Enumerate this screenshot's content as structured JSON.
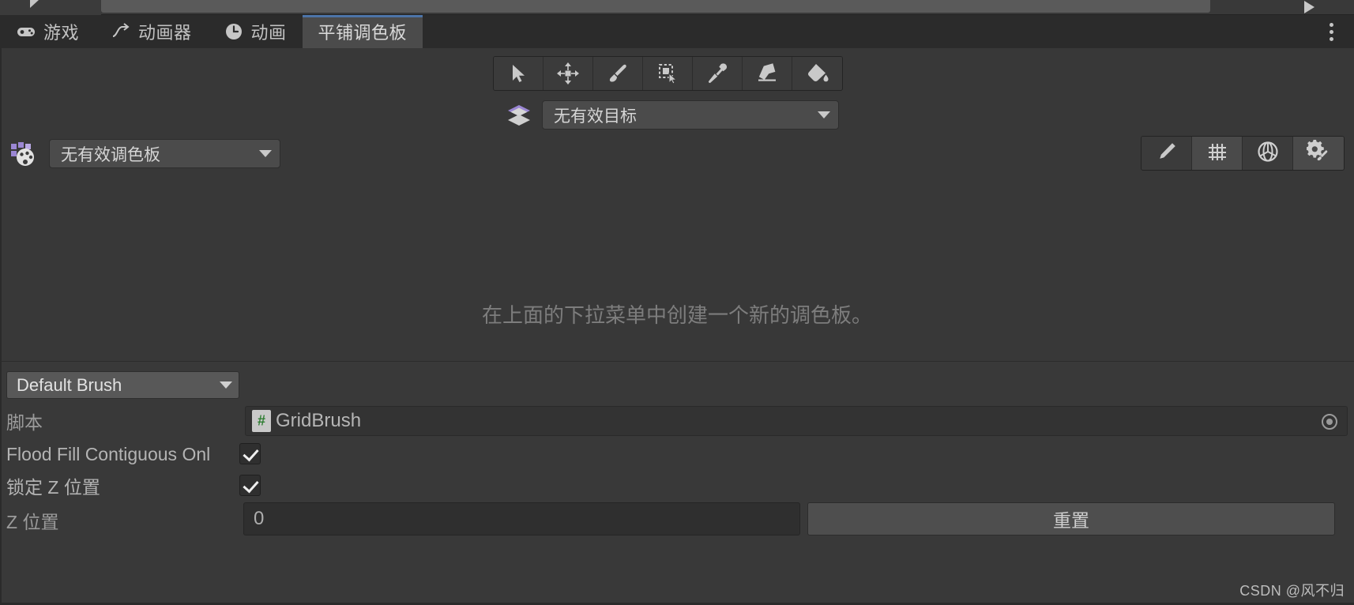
{
  "window": {
    "title": "平铺调色板",
    "kebab_icon": "kebab-menu-icon"
  },
  "tabs": [
    {
      "label": "游戏",
      "icon": "gamepad-icon",
      "active": false
    },
    {
      "label": "动画器",
      "icon": "animator-icon",
      "active": false
    },
    {
      "label": "动画",
      "icon": "clock-icon",
      "active": false
    },
    {
      "label": "平铺调色板",
      "icon": "",
      "active": true
    }
  ],
  "toolbar": {
    "tools": [
      {
        "name": "select-tool",
        "icon": "cursor-arrow-icon",
        "active": false
      },
      {
        "name": "move-tool",
        "icon": "move-arrows-icon",
        "active": false
      },
      {
        "name": "paint-tool",
        "icon": "paintbrush-icon",
        "active": false
      },
      {
        "name": "box-fill-tool",
        "icon": "box-select-icon",
        "active": false
      },
      {
        "name": "picker-tool",
        "icon": "eyedropper-icon",
        "active": false
      },
      {
        "name": "erase-tool",
        "icon": "eraser-icon",
        "active": false
      },
      {
        "name": "fill-tool",
        "icon": "paint-bucket-icon",
        "active": false
      }
    ]
  },
  "target": {
    "icon": "tilemap-layers-icon",
    "value": "无有效目标"
  },
  "palette": {
    "icon": "tile-palette-icon",
    "value": "无有效调色板"
  },
  "right_tools": [
    {
      "name": "edit-palette-button",
      "icon": "pencil-icon",
      "highlighted": false
    },
    {
      "name": "grid-toggle-button",
      "icon": "grid-icon",
      "highlighted": true
    },
    {
      "name": "gizmo-toggle-button",
      "icon": "globe-gizmo-icon",
      "highlighted": false
    },
    {
      "name": "brush-settings-button",
      "icon": "gear-brush-icon",
      "highlighted": true
    }
  ],
  "empty_message": "在上面的下拉菜单中创建一个新的调色板。",
  "brush_panel": {
    "brush_select": "Default Brush",
    "script_label": "脚本",
    "script_value": "GridBrush",
    "script_icon": "csharp-script-icon",
    "flood_fill_label": "Flood Fill Contiguous Onl",
    "flood_fill_checked": true,
    "lock_z_label": "锁定 Z 位置",
    "lock_z_checked": true,
    "z_position_label": "Z 位置",
    "z_position_value": "0",
    "reset_label": "重置"
  },
  "watermark": "CSDN @风不归",
  "colors": {
    "window_bg": "#383838",
    "tabbar_bg": "#2b2b2b",
    "active_tab_bg": "#4b4b4b",
    "active_tab_accent": "#4d74a8",
    "panel_bg": "#393939",
    "field_bg": "#2f2f2f",
    "dropdown_bg": "#4b4b4b",
    "text": "#c2c2c2",
    "muted_text": "#7d7d7d",
    "accent_purple": "#9b87d4",
    "script_green": "#2e7d32"
  }
}
